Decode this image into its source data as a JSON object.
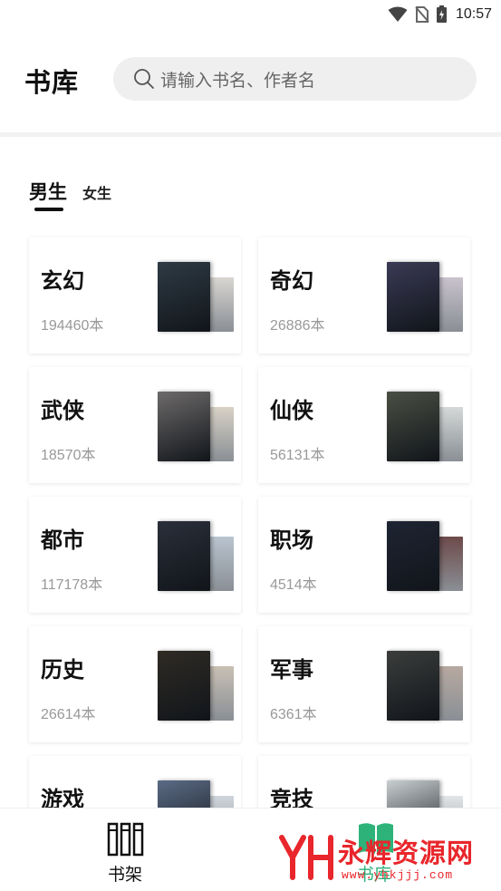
{
  "status_bar": {
    "time": "10:57",
    "icons": [
      "wifi-icon",
      "no-sim-icon",
      "battery-charging-icon"
    ]
  },
  "header": {
    "title": "书库",
    "search": {
      "placeholder": "请输入书名、作者名",
      "icon": "search-icon"
    }
  },
  "tabs": [
    {
      "label": "男生",
      "active": true
    },
    {
      "label": "女生",
      "active": false
    }
  ],
  "categories": [
    {
      "name": "玄幻",
      "count": "194460本",
      "cover_colors": [
        "#2e3a44",
        "#d9d6d2"
      ]
    },
    {
      "name": "奇幻",
      "count": "26886本",
      "cover_colors": [
        "#3a3a55",
        "#c9c2cc"
      ]
    },
    {
      "name": "武侠",
      "count": "18570本",
      "cover_colors": [
        "#6d6a6a",
        "#d8d2c6"
      ]
    },
    {
      "name": "仙侠",
      "count": "56131本",
      "cover_colors": [
        "#4a4f44",
        "#d5d9d8"
      ]
    },
    {
      "name": "都市",
      "count": "117178本",
      "cover_colors": [
        "#2a2f3a",
        "#b9c4cf"
      ]
    },
    {
      "name": "职场",
      "count": "4514本",
      "cover_colors": [
        "#1f2433",
        "#6d4a4a"
      ]
    },
    {
      "name": "历史",
      "count": "26614本",
      "cover_colors": [
        "#2f2b25",
        "#c8c0b4"
      ]
    },
    {
      "name": "军事",
      "count": "6361本",
      "cover_colors": [
        "#3b3d3c",
        "#b7a9a0"
      ]
    },
    {
      "name": "游戏",
      "count": "",
      "cover_colors": [
        "#5b6b85",
        "#cfd5dc"
      ]
    },
    {
      "name": "竞技",
      "count": "",
      "cover_colors": [
        "#c9cfd1",
        "#e3e6e8"
      ]
    }
  ],
  "bottom_nav": {
    "shelf_label": "书架",
    "library_label": "书库",
    "shelf_icon": "bookshelf-icon",
    "library_icon": "library-book-icon"
  },
  "watermark": {
    "text": "永辉资源网",
    "url": "www.yhkjjj.com",
    "logo": "yh-logo-icon",
    "color": "#e8262b"
  }
}
